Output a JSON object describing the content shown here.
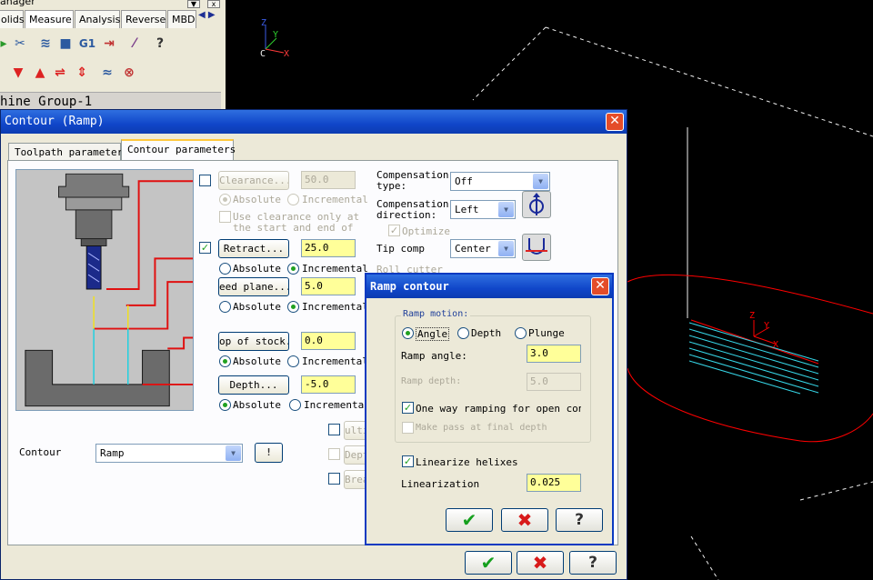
{
  "manager": {
    "title": "anager",
    "tabs": [
      "olids",
      "Measure",
      "Analysis",
      "Reverse",
      "MBD"
    ],
    "group": "hine Group-1"
  },
  "viewport": {
    "axis_labels": {
      "z": "Z",
      "y": "Y",
      "c": "C",
      "x": "X"
    },
    "part_axis_labels": {
      "z": "Z",
      "y": "Y",
      "x": "X"
    }
  },
  "dialog": {
    "title": "Contour (Ramp)",
    "tabs": [
      {
        "label": "Toolpath parameters",
        "active": false
      },
      {
        "label": "Contour parameters",
        "active": true
      }
    ],
    "clearance": {
      "label": "Clearance...",
      "value": "50.0",
      "checked": false,
      "enabled": false,
      "absolute": "Absolute",
      "incremental": "Incremental",
      "mode": "absolute",
      "use_clearance_label": "Use clearance only at the start and end of"
    },
    "retract": {
      "label": "Retract...",
      "value": "25.0",
      "checked": true,
      "absolute": "Absolute",
      "incremental": "Incremental",
      "mode": "incremental"
    },
    "feed_plane": {
      "label": "eed plane...",
      "value": "5.0",
      "absolute": "Absolute",
      "incremental": "Incremental",
      "mode": "incremental"
    },
    "top_of_stock": {
      "label": "op of stock...",
      "value": "0.0",
      "absolute": "Absolute",
      "incremental": "Incremental",
      "mode": "absolute"
    },
    "depth": {
      "label": "Depth...",
      "value": "-5.0",
      "absolute": "Absolute",
      "incremental": "Incremental",
      "mode": "absolute"
    },
    "compensation_type": {
      "label": "Compensation type:",
      "value": "Off"
    },
    "compensation_direction": {
      "label": "Compensation direction:",
      "value": "Left"
    },
    "optimize": {
      "label": "Optimize",
      "checked": true
    },
    "tip_comp": {
      "label": "Tip comp",
      "value": "Center"
    },
    "roll_cutter": {
      "label": "Roll cutter"
    },
    "side_checks": [
      "ulti",
      "Dept",
      "Brea"
    ],
    "contour": {
      "label": "Contour",
      "value": "Ramp"
    },
    "ok_icon": "✔",
    "cancel_icon": "✖",
    "help_icon": "?"
  },
  "ramp_dialog": {
    "title": "Ramp contour",
    "ramp_motion_label": "Ramp motion:",
    "motion_options": [
      "Angle",
      "Depth",
      "Plunge"
    ],
    "motion_selected": "Angle",
    "ramp_angle": {
      "label": "Ramp angle:",
      "value": "3.0"
    },
    "ramp_depth": {
      "label": "Ramp depth:",
      "value": "5.0"
    },
    "one_way": {
      "label": "One way ramping for open conto",
      "checked": true
    },
    "final_pass": {
      "label": "Make pass at final depth",
      "checked": false
    },
    "linearize": {
      "label": "Linearize helixes",
      "checked": true
    },
    "linearization": {
      "label": "Linearization",
      "value": "0.025"
    },
    "ok_icon": "✔",
    "cancel_icon": "✖",
    "help_icon": "?"
  },
  "colors": {
    "title_bar": "#1046c9",
    "field_highlight": "#ffff99",
    "viewport_bg": "#000000",
    "part_outline": "#ff0000",
    "toolpath": "#36d6e7"
  }
}
